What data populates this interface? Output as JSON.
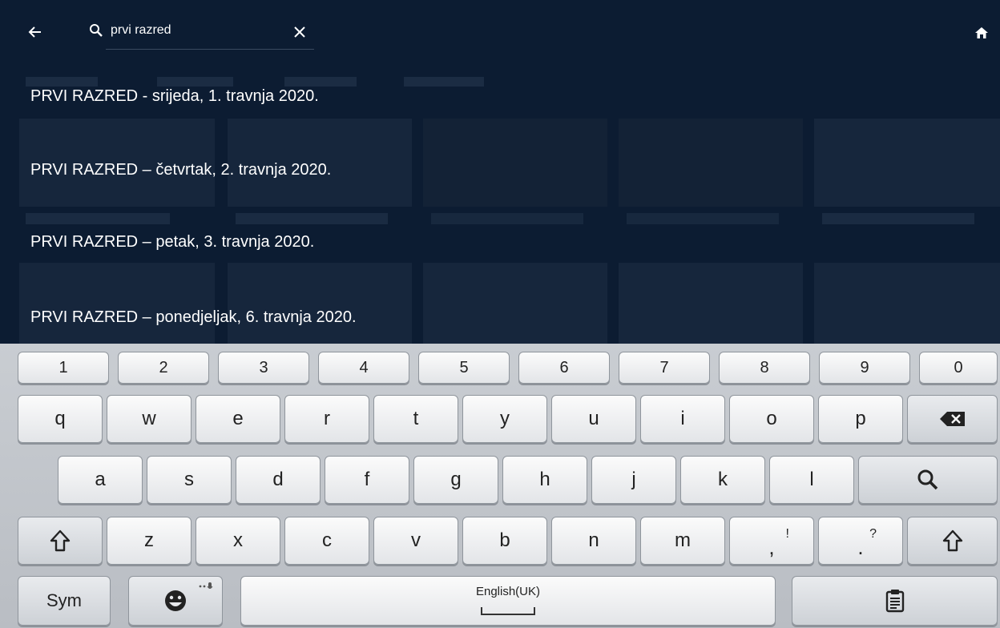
{
  "search": {
    "query": "prvi razred"
  },
  "suggestions": [
    "PRVI RAZRED - srijeda, 1. travnja 2020.",
    "PRVI RAZRED – četvrtak, 2. travnja 2020.",
    "PRVI RAZRED – petak, 3. travnja 2020.",
    "PRVI RAZRED – ponedjeljak, 6. travnja 2020."
  ],
  "keyboard": {
    "numbers": [
      "1",
      "2",
      "3",
      "4",
      "5",
      "6",
      "7",
      "8",
      "9",
      "0"
    ],
    "row1": [
      "q",
      "w",
      "e",
      "r",
      "t",
      "y",
      "u",
      "i",
      "o",
      "p"
    ],
    "row2": [
      "a",
      "s",
      "d",
      "f",
      "g",
      "h",
      "j",
      "k",
      "l"
    ],
    "row3": [
      "z",
      "x",
      "c",
      "v",
      "b",
      "n",
      "m"
    ],
    "comma": ",",
    "comma_alt": "!",
    "period": ".",
    "period_alt": "?",
    "sym_label": "Sym",
    "space_label": "English(UK)"
  },
  "colors": {
    "background": "#0c1c32",
    "keyboard": "#c4c8cd",
    "text": "#ffffff"
  }
}
